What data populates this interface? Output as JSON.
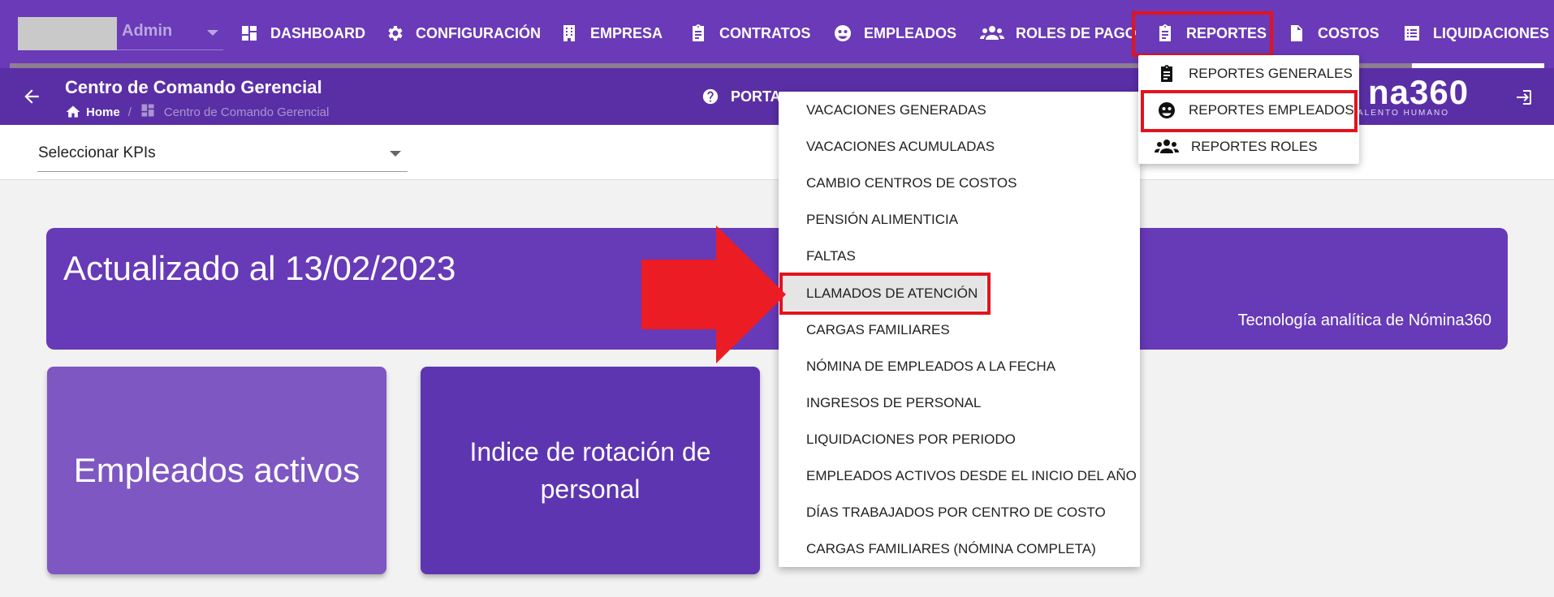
{
  "user": {
    "name": "Admin"
  },
  "nav": {
    "dashboard": "DASHBOARD",
    "configuracion": "CONFIGURACIÓN",
    "empresa": "EMPRESA",
    "contratos": "CONTRATOS",
    "empleados": "EMPLEADOS",
    "roles": "ROLES DE PAGO",
    "reportes": "REPORTES",
    "costos": "COSTOS",
    "liquidaciones": "LIQUIDACIONES"
  },
  "header": {
    "title": "Centro de Comando Gerencial",
    "breadcrumb_home": "Home",
    "breadcrumb_sep": "/",
    "breadcrumb_current": "Centro de Comando Gerencial",
    "portal": "PORTA",
    "brand": "na360",
    "brand_tagline": "ALENTO HUMANO"
  },
  "kpi": {
    "label": "Seleccionar KPIs"
  },
  "banner": {
    "title": "Actualizado al 13/02/2023",
    "subtitle": "Tecnología analítica de Nómina360"
  },
  "cards": {
    "empleados_activos": "Empleados activos",
    "rotacion": "Indice de rotación de personal"
  },
  "reportes_menu": {
    "generales": "REPORTES GENERALES",
    "empleados": "REPORTES EMPLEADOS",
    "roles": "REPORTES ROLES"
  },
  "empleados_menu": [
    "VACACIONES GENERADAS",
    "VACACIONES ACUMULADAS",
    "CAMBIO CENTROS DE COSTOS",
    "PENSIÓN ALIMENTICIA",
    "FALTAS",
    "LLAMADOS DE ATENCIÓN",
    "CARGAS FAMILIARES",
    "NÓMINA DE EMPLEADOS A LA FECHA",
    "INGRESOS DE PERSONAL",
    "LIQUIDACIONES POR PERIODO",
    "EMPLEADOS ACTIVOS DESDE EL INICIO DEL AÑO",
    "DÍAS TRABAJADOS POR CENTRO DE COSTO",
    "CARGAS FAMILIARES (NÓMINA COMPLETA)"
  ],
  "colors": {
    "nav_bg": "#6a3ab8",
    "subbar_bg": "#5a2fa6",
    "banner_bg": "#673ab7",
    "highlight": "#e3131c"
  }
}
